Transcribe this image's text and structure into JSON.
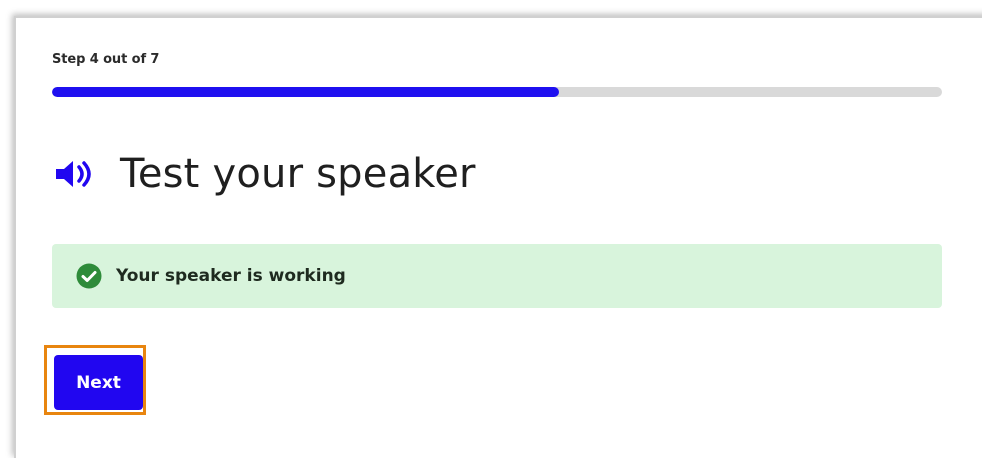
{
  "step": {
    "label": "Step 4 out of 7",
    "progress_fraction": 0.57
  },
  "title": {
    "icon": "speaker-icon",
    "text": "Test your speaker"
  },
  "status": {
    "icon": "check-circle-icon",
    "text": "Your speaker is working"
  },
  "actions": {
    "next_label": "Next"
  },
  "colors": {
    "accent": "#2106f0",
    "progress_track": "#d9d9d9",
    "success_bg": "#d8f4dc",
    "success_icon": "#2e8b3a",
    "focus_ring": "#e8850f"
  }
}
